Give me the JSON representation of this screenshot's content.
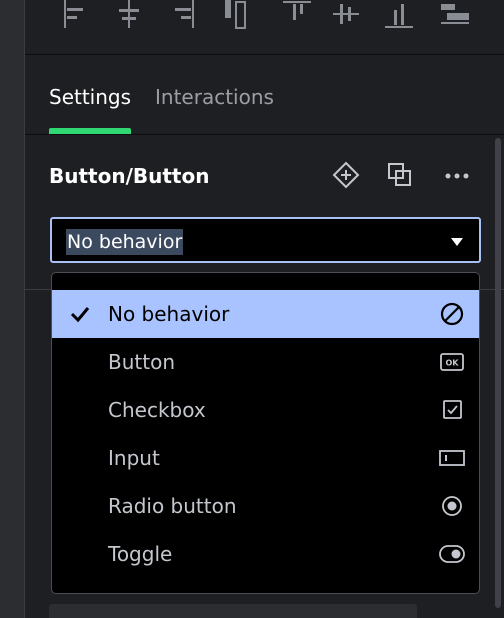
{
  "tabs": [
    {
      "label": "Settings",
      "active": true
    },
    {
      "label": "Interactions",
      "active": false
    }
  ],
  "component": {
    "title": "Button/Button",
    "header_icons": [
      "component-icon",
      "detach-icon",
      "more-icon"
    ]
  },
  "behavior_select": {
    "value": "No behavior"
  },
  "behavior_options": [
    {
      "label": "No behavior",
      "icon": "no-behavior-icon",
      "selected": true
    },
    {
      "label": "Button",
      "icon": "button-ok-icon",
      "selected": false
    },
    {
      "label": "Checkbox",
      "icon": "checkbox-icon",
      "selected": false
    },
    {
      "label": "Input",
      "icon": "input-icon",
      "selected": false
    },
    {
      "label": "Radio button",
      "icon": "radio-icon",
      "selected": false
    },
    {
      "label": "Toggle",
      "icon": "toggle-icon",
      "selected": false
    }
  ],
  "toolbar_icons": [
    "align-left-icon",
    "align-horizontal-center-icon",
    "align-right-icon",
    "distribute-horizontal-icon",
    "align-top-icon",
    "align-vertical-center-icon",
    "align-bottom-icon",
    "distribute-vertical-icon"
  ],
  "colors": {
    "accent_green": "#2fd872",
    "selected_bg": "#a8c3ff",
    "select_border": "#a9c0f7"
  }
}
